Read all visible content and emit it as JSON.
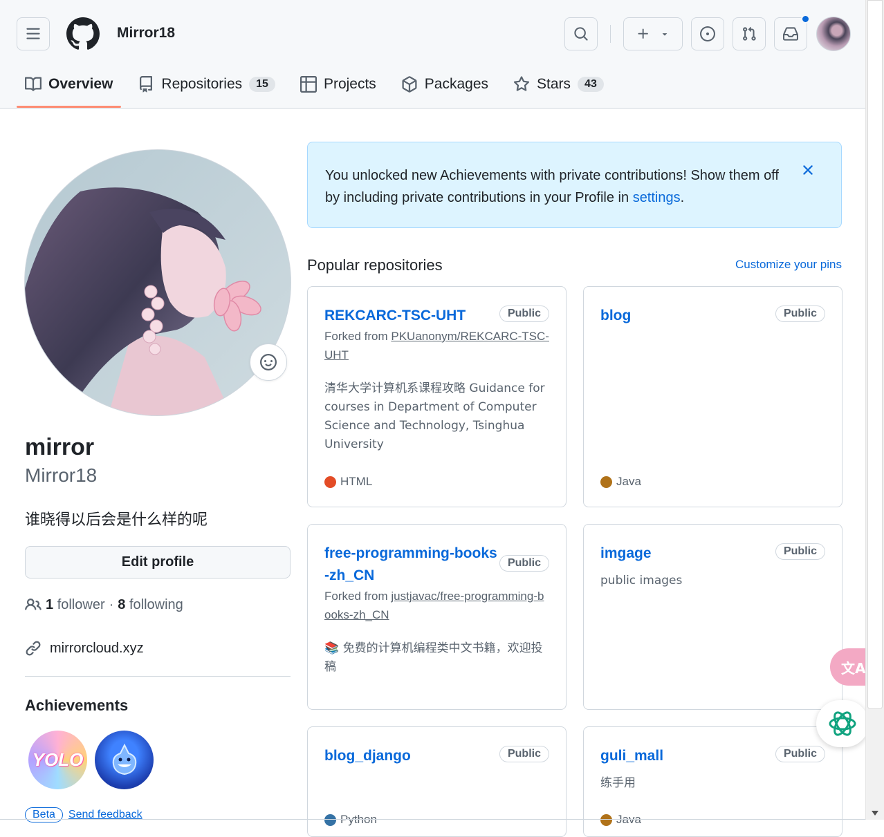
{
  "header": {
    "username": "Mirror18"
  },
  "tabs": [
    {
      "label": "Overview"
    },
    {
      "label": "Repositories",
      "count": "15"
    },
    {
      "label": "Projects"
    },
    {
      "label": "Packages"
    },
    {
      "label": "Stars",
      "count": "43"
    }
  ],
  "profile": {
    "fullname": "mirror",
    "login": "Mirror18",
    "bio": "谁晓得以后会是什么样的呢",
    "edit_label": "Edit profile",
    "followers_count": "1",
    "followers_label": "follower",
    "dot": "·",
    "following_count": "8",
    "following_label": "following",
    "website": "mirrorcloud.xyz",
    "achievements_title": "Achievements",
    "badge_yolo_text": "YOLO",
    "beta_label": "Beta",
    "feedback_label": "Send feedback"
  },
  "flash": {
    "message": "You unlocked new Achievements with private contributions! Show them off by including private contributions in your Profile in ",
    "link": "settings",
    "end": "."
  },
  "popular": {
    "title": "Popular repositories",
    "customize": "Customize your pins"
  },
  "repos": [
    {
      "name": "REKCARC-TSC-UHT",
      "visibility": "Public",
      "forked_prefix": "Forked from ",
      "forked_from": "PKUanonym/REKCARC-TSC-UHT",
      "description": "清华大学计算机系课程攻略 Guidance for courses in Department of Computer Science and Technology, Tsinghua University",
      "language": "HTML",
      "lang_color": "#e34c26"
    },
    {
      "name": "blog",
      "visibility": "Public",
      "language": "Java",
      "lang_color": "#b07219"
    },
    {
      "name": "free-programming-books-zh_CN",
      "visibility": "Public",
      "forked_prefix": "Forked from ",
      "forked_from": "justjavac/free-programming-books-zh_CN",
      "description": "📚 免费的计算机编程类中文书籍，欢迎投稿"
    },
    {
      "name": "imgage",
      "visibility": "Public",
      "description": "public images"
    },
    {
      "name": "blog_django",
      "visibility": "Public",
      "language": "Python",
      "lang_color": "#3572A5"
    },
    {
      "name": "guli_mall",
      "visibility": "Public",
      "description": "练手用",
      "language": "Java",
      "lang_color": "#b07219"
    }
  ],
  "widgets": {
    "translate_label": "文A"
  },
  "icons": [
    "menu-icon",
    "github-logo-icon",
    "search-icon",
    "plus-icon",
    "chevron-down-icon",
    "issue-icon",
    "pull-request-icon",
    "inbox-icon",
    "book-icon",
    "repo-icon",
    "table-icon",
    "package-icon",
    "star-icon",
    "smiley-icon",
    "people-icon",
    "link-icon",
    "close-icon",
    "ai-assistant-icon"
  ]
}
